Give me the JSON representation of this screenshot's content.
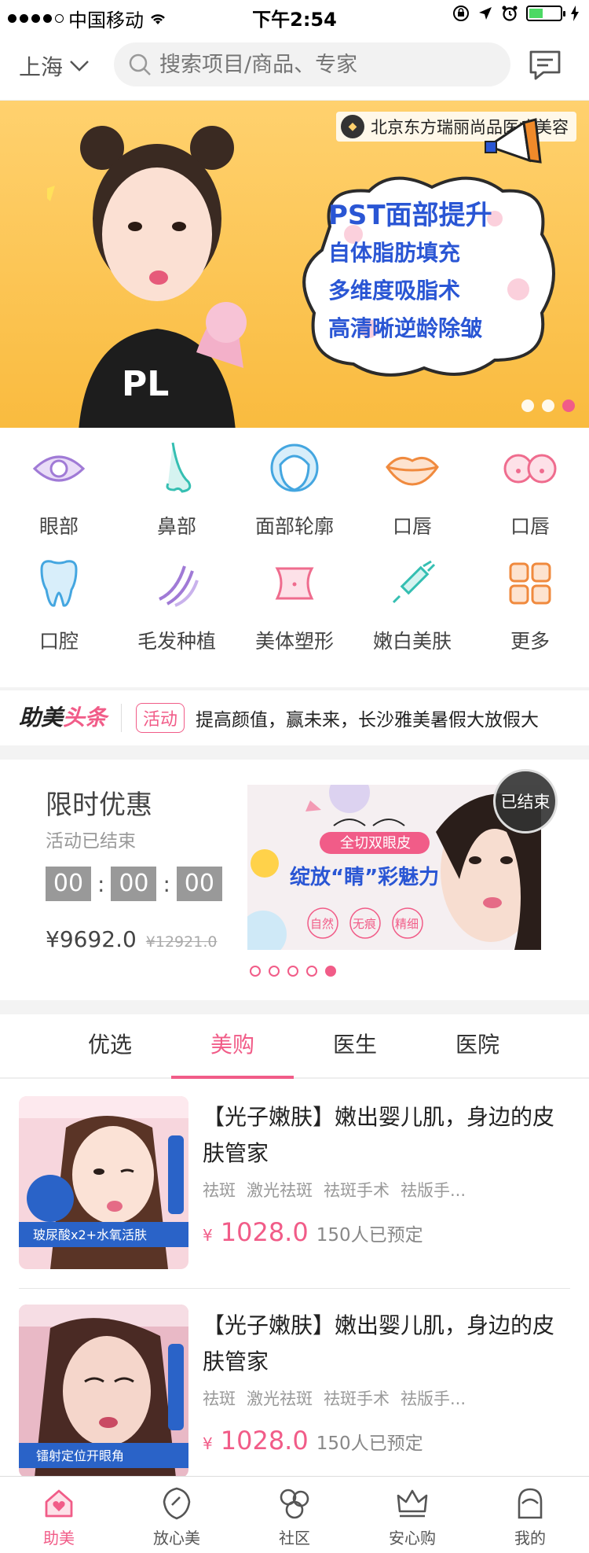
{
  "status_bar": {
    "carrier": "中国移动",
    "time": "下午2:54"
  },
  "header": {
    "city": "上海",
    "search_placeholder": "搜索项目/商品、专家"
  },
  "banner": {
    "brand": "北京东方瑞丽尚品医疗美容",
    "lines": [
      "PST面部提升",
      "自体脂肪填充",
      "多维度吸脂术",
      "高清晰逆龄除皱"
    ]
  },
  "categories": [
    {
      "label": "眼部",
      "icon": "eye-icon"
    },
    {
      "label": "鼻部",
      "icon": "nose-icon"
    },
    {
      "label": "面部轮廓",
      "icon": "face-contour-icon"
    },
    {
      "label": "口唇",
      "icon": "lips-icon"
    },
    {
      "label": "口唇",
      "icon": "chest-icon"
    },
    {
      "label": "口腔",
      "icon": "tooth-icon"
    },
    {
      "label": "毛发种植",
      "icon": "hair-icon"
    },
    {
      "label": "美体塑形",
      "icon": "body-shaping-icon"
    },
    {
      "label": "嫩白美肤",
      "icon": "syringe-icon"
    },
    {
      "label": "更多",
      "icon": "more-grid-icon"
    }
  ],
  "headlines": {
    "logo_a": "助美",
    "logo_b": "头条",
    "tag": "活动",
    "text": "提高颜值，赢未来，长沙雅美暑假大放假大"
  },
  "flash_sale": {
    "title": "限时优惠",
    "subtitle": "活动已结束",
    "hours": "00",
    "minutes": "00",
    "seconds": "00",
    "price": "¥9692.0",
    "original_price": "¥12921.0",
    "ended_badge": "已结束",
    "promo": {
      "tag": "全切双眼皮",
      "headline": "绽放“睛”彩魅力",
      "chips": [
        "自然",
        "无痕",
        "精细"
      ]
    },
    "active_dot": 4
  },
  "tabs": [
    "优选",
    "美购",
    "医生",
    "医院"
  ],
  "active_tab": 1,
  "products": [
    {
      "title": "【光子嫩肤】嫩出婴儿肌，身边的皮肤管家",
      "tags": [
        "祛斑",
        "激光祛斑",
        "祛斑手术",
        "祛版手..."
      ],
      "currency": "¥",
      "price": "1028.0",
      "booked": "150人已预定",
      "image_caption": "玻尿酸x2+水氧活肤"
    },
    {
      "title": "【光子嫩肤】嫩出婴儿肌，身边的皮肤管家",
      "tags": [
        "祛斑",
        "激光祛斑",
        "祛斑手术",
        "祛版手..."
      ],
      "currency": "¥",
      "price": "1028.0",
      "booked": "150人已预定",
      "image_caption": "镭射定位开眼角"
    }
  ],
  "tabbar": [
    {
      "label": "助美",
      "icon": "home-heart-icon"
    },
    {
      "label": "放心美",
      "icon": "shield-icon"
    },
    {
      "label": "社区",
      "icon": "community-icon"
    },
    {
      "label": "安心购",
      "icon": "crown-icon"
    },
    {
      "label": "我的",
      "icon": "profile-icon"
    }
  ],
  "active_tabbar": 0,
  "colors": {
    "accent": "#f15c88",
    "banner_bg": "#f9bb3f"
  }
}
